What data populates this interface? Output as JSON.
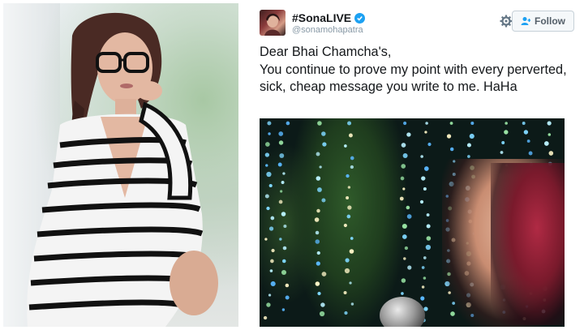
{
  "tweet": {
    "display_name": "#SonaLIVE",
    "handle": "@sonamohapatra",
    "follow_label": "Follow",
    "text": "Dear Bhai Chamcha's,\nYou continue to prove my point with every perverted, sick, cheap message you write to me. HaHa"
  },
  "icons": {
    "verified": "verified-badge-icon",
    "settings": "gear-icon",
    "follow": "add-user-icon"
  },
  "colors": {
    "accent": "#1da1f2",
    "text": "#14171a",
    "muted": "#8899a6"
  }
}
